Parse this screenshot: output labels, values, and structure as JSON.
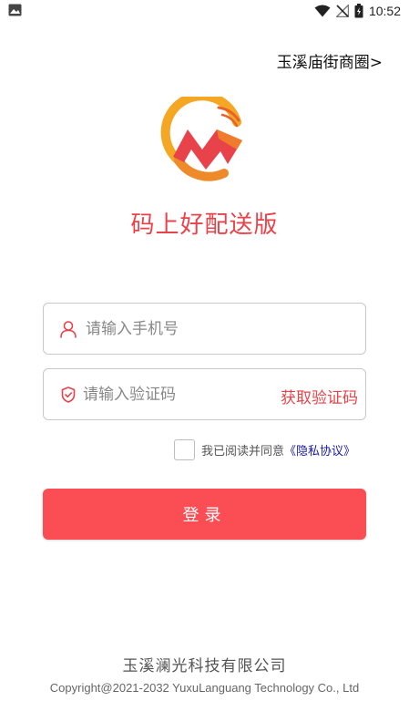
{
  "status_bar": {
    "time": "10:52",
    "battery_level": "90%",
    "icons": [
      "image-icon",
      "wifi-icon",
      "no-signal-icon",
      "battery-icon"
    ]
  },
  "header": {
    "region_link": "玉溪庙街商圈>"
  },
  "app": {
    "title": "码上好配送版",
    "logo_icon": "app-logo-icon",
    "brand_colors": {
      "red": "#e8434a",
      "orange": "#f5a623",
      "deep_orange": "#e8622c"
    }
  },
  "form": {
    "phone": {
      "placeholder": "请输入手机号",
      "value": "",
      "icon": "user-icon"
    },
    "code": {
      "placeholder": "请输入验证码",
      "value": "",
      "icon": "shield-check-icon",
      "get_code_label": "获取验证码"
    },
    "agreement": {
      "checked": false,
      "text": "我已阅读并同意",
      "link_text": "《隐私协议》"
    },
    "login_label": "登录",
    "login_color": "#fa4d54"
  },
  "footer": {
    "company": "玉溪澜光科技有限公司",
    "copyright": "Copyright@2021-2032 YuxuLanguang Technology Co., Ltd"
  }
}
